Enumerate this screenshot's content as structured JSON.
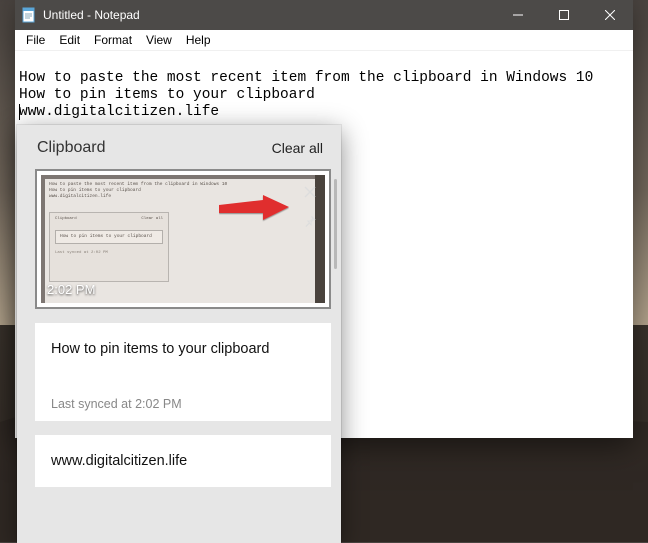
{
  "window": {
    "title": "Untitled - Notepad",
    "menus": [
      "File",
      "Edit",
      "Format",
      "View",
      "Help"
    ]
  },
  "editor": {
    "line1": "How to paste the most recent item from the clipboard in Windows 10",
    "line2": "How to pin items to your clipboard",
    "line3": "www.digitalcitizen.life"
  },
  "clipboard": {
    "title": "Clipboard",
    "clear_label": "Clear all",
    "items": [
      {
        "type": "image",
        "timestamp": "2:02 PM",
        "mini_l1": "How to paste the most recent item from the clipboard in Windows 10",
        "mini_l2": "How to pin items to your clipboard",
        "mini_l3": "www.digitalcitizen.life",
        "mini_popup_title": "Clipboard",
        "mini_popup_clear": "Clear all",
        "mini_card_text": "How to pin items to your clipboard",
        "mini_sync": "Last synced at 2:02 PM"
      },
      {
        "type": "text",
        "content": "How to pin items to your clipboard",
        "synced": "Last synced at 2:02 PM"
      },
      {
        "type": "text",
        "content": "www.digitalcitizen.life"
      }
    ]
  }
}
